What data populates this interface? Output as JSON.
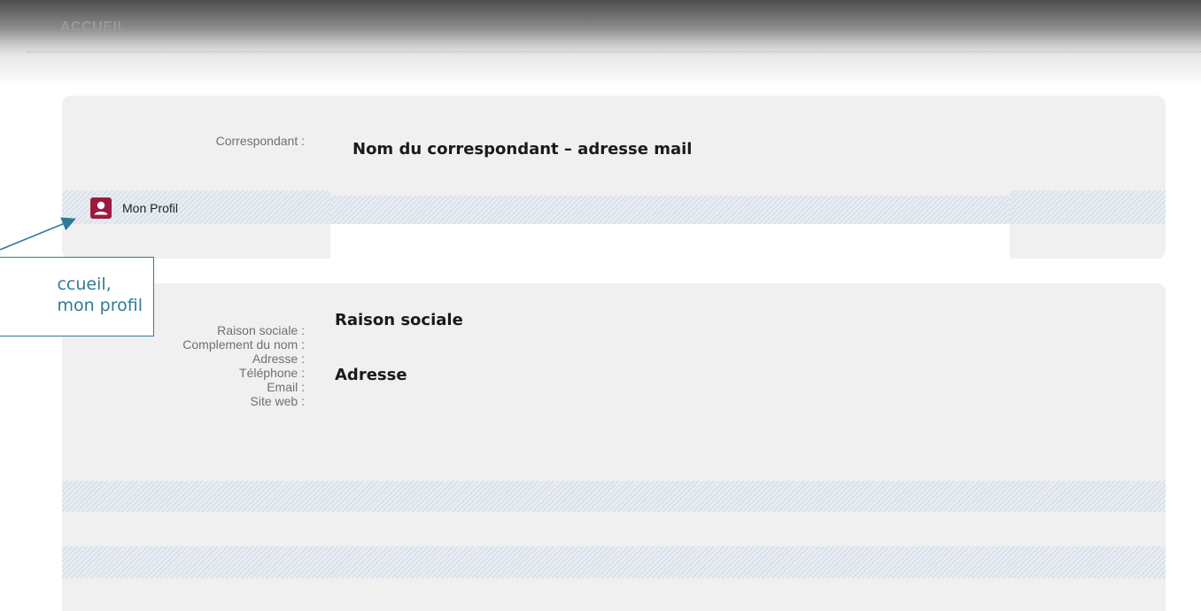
{
  "header": {
    "title": "ACCUEIL"
  },
  "profile_card": {
    "correspondant_label": "Correspondant :",
    "correspondant_value": "Nom du correspondant – adresse mail",
    "profile_link_label": "Mon Profil",
    "profile_icon": "user-badge-icon"
  },
  "company_card": {
    "fields": [
      {
        "label": "Raison sociale :",
        "value": "Raison sociale"
      },
      {
        "label": "Complement du nom :",
        "value": ""
      },
      {
        "label": "Adresse :",
        "value": "Adresse"
      },
      {
        "label": "Téléphone :",
        "value": ""
      },
      {
        "label": "Email :",
        "value": ""
      },
      {
        "label": "Site web :",
        "value": ""
      }
    ]
  },
  "annotation": {
    "line1": "ccueil,",
    "line2": "mon profil"
  },
  "colors": {
    "accent_icon": "#9b1b3f",
    "annotation": "#2f7b96",
    "card_background": "#f0f0f0"
  }
}
